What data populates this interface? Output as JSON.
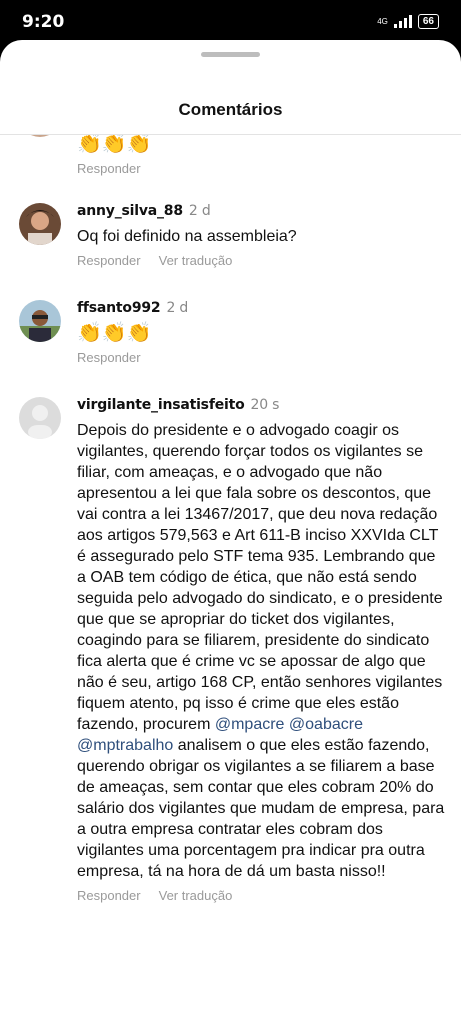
{
  "status": {
    "time": "9:20",
    "network": "4G",
    "battery": "66"
  },
  "header": {
    "title": "Comentários"
  },
  "comments": [
    {
      "username": "",
      "time": "",
      "text": "👏👏👏",
      "reply": "Responder",
      "translate": ""
    },
    {
      "username": "anny_silva_88",
      "time": "2 d",
      "text": "Oq foi definido na assembleia?",
      "reply": "Responder",
      "translate": "Ver tradução"
    },
    {
      "username": "ffsanto992",
      "time": "2 d",
      "text": "👏👏👏",
      "reply": "Responder",
      "translate": ""
    },
    {
      "username": "virgilante_insatisfeito",
      "time": "20 s",
      "text_part1": "Depois do presidente e o advogado coagir os vigilantes, querendo forçar todos os vigilantes se filiar, com ameaças, e o advogado que não apresentou a lei que fala sobre os descontos, que vai contra a lei 13467/2017, que deu nova redação aos artigos 579,563 e Art 611-B inciso XXVIda CLT é assegurado pelo STF tema 935. Lembrando que a OAB tem código de ética, que não está sendo seguida pelo advogado do sindicato, e o presidente que que se apropriar do ticket dos vigilantes, coagindo para se filiarem, presidente do sindicato fica alerta que é crime vc se apossar de algo que não é seu, artigo 168 CP, então senhores vigilantes fiquem atento, pq isso é crime que eles estão fazendo, procurem",
      "mentions": [
        "@mpacre",
        "@oabacre",
        "@mptrabalho"
      ],
      "text_part2": "analisem o que eles estão fazendo, querendo obrigar os vigilantes a se filiarem a base de ameaças, sem contar que eles cobram 20% do salário dos vigilantes que mudam de empresa, para a outra empresa contratar eles cobram dos vigilantes uma porcentagem pra indicar pra outra empresa, tá na hora de dá um basta nisso!!",
      "reply": "Responder",
      "translate": "Ver tradução"
    }
  ]
}
